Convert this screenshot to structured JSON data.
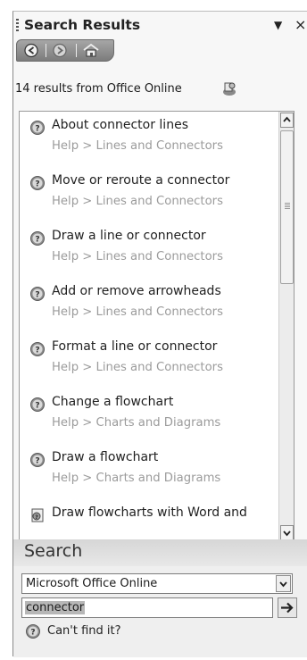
{
  "pane": {
    "title": "Search Results",
    "dropdown_glyph": "▼",
    "close_glyph": "×"
  },
  "nav": {
    "back_icon": "back-arrow-icon",
    "forward_icon": "forward-arrow-icon",
    "home_icon": "home-icon"
  },
  "results_summary": "14 results from Office Online",
  "results": [
    {
      "title": "About connector lines",
      "path": "Help > Lines and Connectors",
      "icon": "help-icon"
    },
    {
      "title": "Move or reroute a connector",
      "path": "Help > Lines and Connectors",
      "icon": "help-icon"
    },
    {
      "title": "Draw a line or connector",
      "path": "Help > Lines and Connectors",
      "icon": "help-icon"
    },
    {
      "title": "Add or remove arrowheads",
      "path": "Help > Lines and Connectors",
      "icon": "help-icon"
    },
    {
      "title": "Format a line or connector",
      "path": "Help > Lines and Connectors",
      "icon": "help-icon"
    },
    {
      "title": "Change a flowchart",
      "path": "Help > Charts and Diagrams",
      "icon": "help-icon"
    },
    {
      "title": "Draw a flowchart",
      "path": "Help > Charts and Diagrams",
      "icon": "help-icon"
    },
    {
      "title": "Draw flowcharts with Word and",
      "path": "",
      "icon": "document-icon"
    }
  ],
  "search": {
    "heading": "Search",
    "source_value": "Microsoft Office Online",
    "query_value": "connector",
    "cant_find_label": "Can't find it?"
  }
}
